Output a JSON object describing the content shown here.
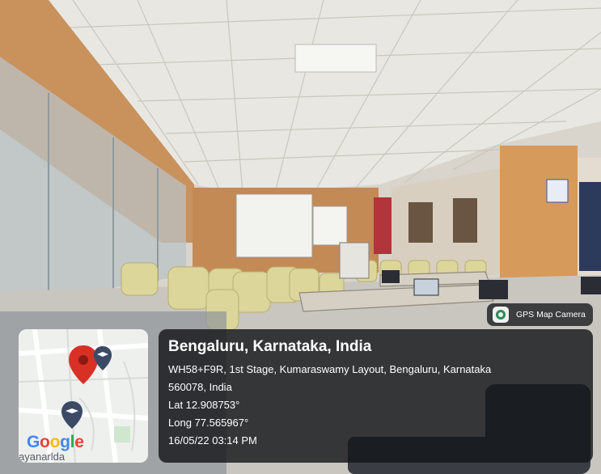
{
  "overlay": {
    "app_badge": "GPS Map Camera",
    "app_icon": "camera-icon",
    "location_title": "Bengaluru, Karnataka, India",
    "address_line1": "WH58+F9R, 1st Stage, Kumaraswamy Layout, Bengaluru, Karnataka",
    "address_line2": "560078, India",
    "latitude": "Lat 12.908753°",
    "longitude": "Long 77.565967°",
    "timestamp": "16/05/22 03:14 PM"
  },
  "map": {
    "logo": "Google",
    "area_label": "ayanarlda",
    "pin_color": "#d93025",
    "secondary_pin_color": "#3c4a66",
    "logo_colors": [
      "#4285f4",
      "#ea4335",
      "#fbbc05",
      "#4285f4",
      "#34a853",
      "#ea4335"
    ]
  },
  "colors": {
    "wall_orange": "#c9915c",
    "ceiling": "#ebe9e3",
    "chair": "#dfd99a",
    "panel_bg": "#14161a"
  }
}
